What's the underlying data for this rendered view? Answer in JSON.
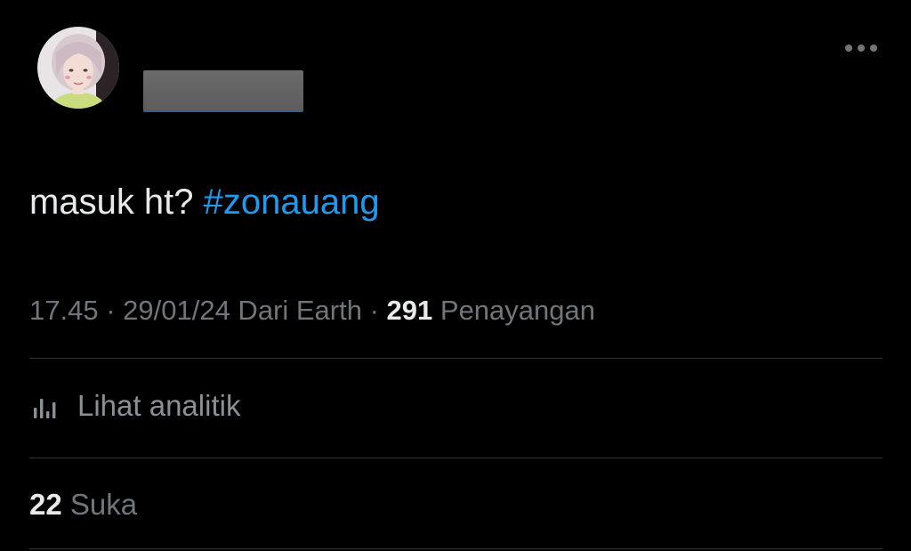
{
  "author": {
    "avatar_icon": "profile-avatar-icon",
    "name_redacted": true
  },
  "menu": {
    "more_icon": "more-horizontal-icon"
  },
  "tweet": {
    "text_prefix": "masuk ht? ",
    "hashtag": "#zonauang"
  },
  "meta": {
    "time": "17.45",
    "sep1": " · ",
    "date": "29/01/24",
    "source": " Dari Earth",
    "sep2": " · ",
    "views_count": "291",
    "views_label": " Penayangan"
  },
  "analytics": {
    "icon": "bar-chart-icon",
    "label": "Lihat analitik"
  },
  "likes": {
    "count": "22",
    "label": " Suka"
  },
  "colors": {
    "background": "#000000",
    "text": "#e7e9ea",
    "secondary_text": "#71767b",
    "link": "#1d9bf0",
    "divider": "#2f3336"
  }
}
